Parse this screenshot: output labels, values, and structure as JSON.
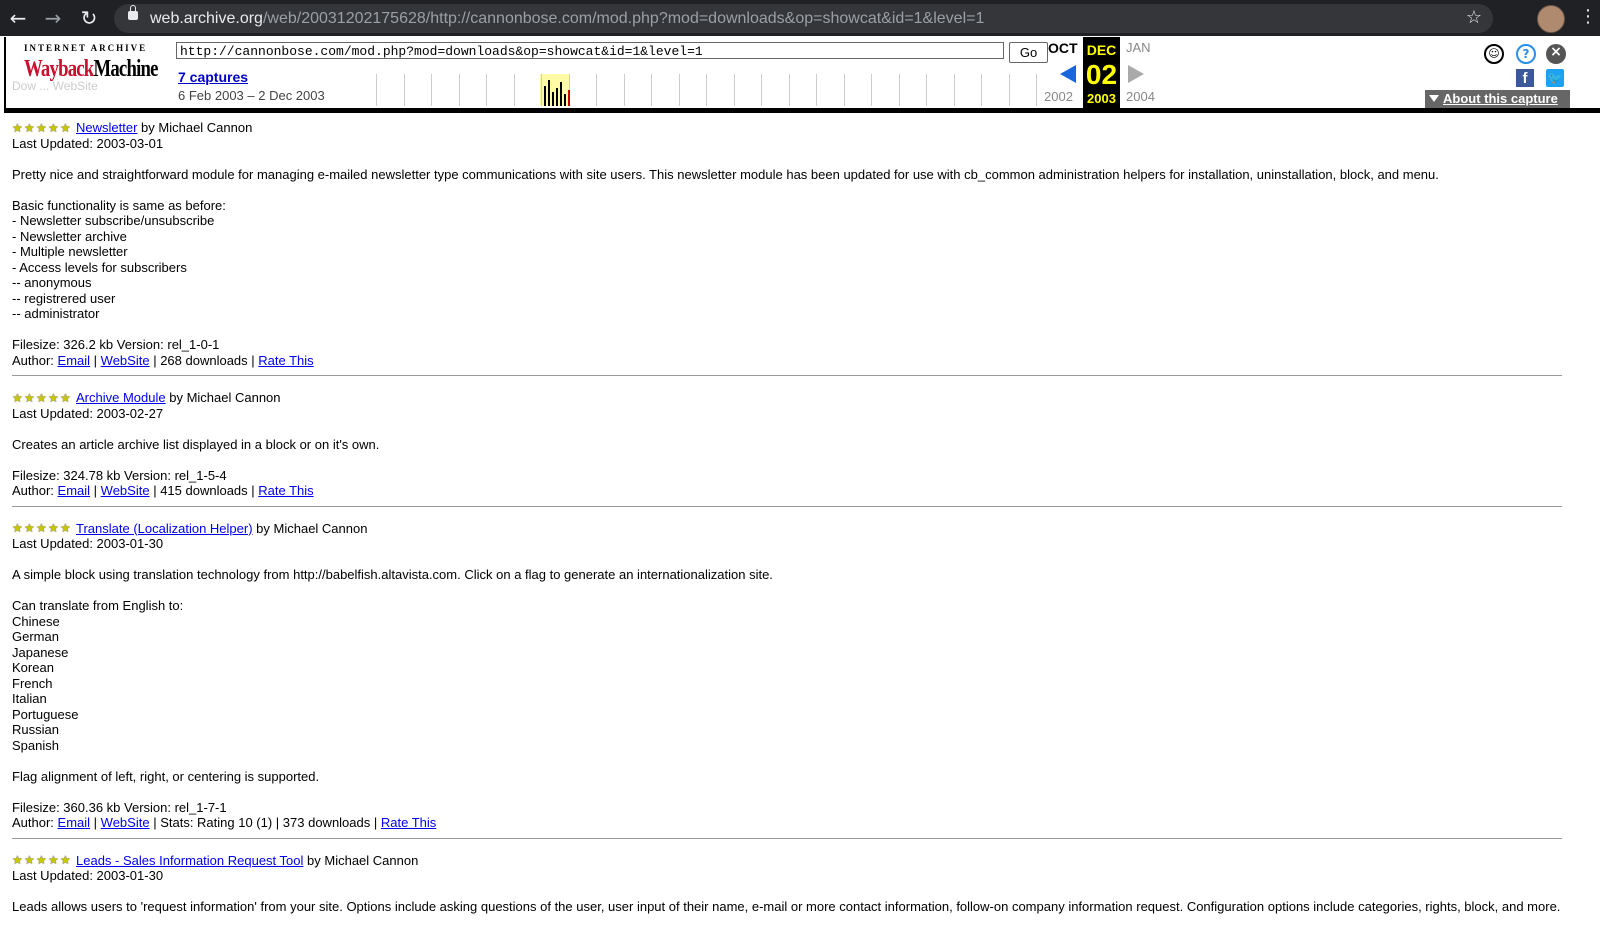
{
  "browser": {
    "url_host": "web.archive.org",
    "url_path": "/web/20031202175628/http://cannonbose.com/mod.php?mod=downloads&op=showcat&id=1&level=1",
    "back_icon": "arrow-left",
    "forward_icon": "arrow-right",
    "reload_icon": "reload",
    "bookmark_icon": "star"
  },
  "wayback": {
    "logo_top": "INTERNET ARCHIVE",
    "logo_main_a": "Wayback",
    "logo_main_b": "Machine",
    "url_value": "http://cannonbose.com/mod.php?mod=downloads&op=showcat&id=1&level=1",
    "go_label": "Go",
    "captures_label": "7 captures",
    "range_label": "6 Feb 2003 – 2 Dec 2003",
    "prev_month": "OCT",
    "cur_month": "DEC",
    "cur_day": "02",
    "next_month": "JAN",
    "prev_year": "2002",
    "cur_year": "2003",
    "next_year": "2004",
    "about_label": "About this capture",
    "ghost_text": "Dow ... WebSite"
  },
  "items": [
    {
      "title": "Newsletter",
      "by": "by Michael Cannon",
      "updated": "Last Updated: 2003-03-01",
      "desc_lines": [
        "Pretty nice and straightforward module for managing e-mailed newsletter type communications with site users. This newsletter module has been updated for use with cb_common administration helpers for installation, uninstallation, block, and menu.",
        "",
        "Basic functionality is same as before:",
        "- Newsletter subscribe/unsubscribe",
        "- Newsletter archive",
        "- Multiple newsletter",
        "- Access levels for subscribers",
        "-- anonymous",
        "-- registrered user",
        "-- administrator"
      ],
      "filesize": "Filesize: 326.2 kb Version: rel_1-0-1",
      "author_prefix": "Author:",
      "email": "Email",
      "website": "WebSite",
      "stats": "| 268 downloads |",
      "rate": "Rate This"
    },
    {
      "title": "Archive Module",
      "by": "by Michael Cannon",
      "updated": "Last Updated: 2003-02-27",
      "desc_lines": [
        "Creates an article archive list displayed in a block or on it's own."
      ],
      "filesize": "Filesize: 324.78 kb Version: rel_1-5-4",
      "author_prefix": "Author:",
      "email": "Email",
      "website": "WebSite",
      "stats": "| 415 downloads |",
      "rate": "Rate This"
    },
    {
      "title": "Translate (Localization Helper)",
      "by": "by Michael Cannon",
      "updated": "Last Updated: 2003-01-30",
      "desc_lines": [
        "A simple block using translation technology from http://babelfish.altavista.com. Click on a flag to generate an internationalization site.",
        "",
        "Can translate from English to:",
        "Chinese",
        "German",
        "Japanese",
        "Korean",
        "French",
        "Italian",
        "Portuguese",
        "Russian",
        "Spanish",
        "",
        "Flag alignment of left, right, or centering is supported."
      ],
      "filesize": "Filesize: 360.36 kb Version: rel_1-7-1",
      "author_prefix": "Author:",
      "email": "Email",
      "website": "WebSite",
      "stats": "| Stats: Rating 10 (1) | 373 downloads |",
      "rate": "Rate This"
    },
    {
      "title": "Leads - Sales Information Request Tool",
      "by": "by Michael Cannon",
      "updated": "Last Updated: 2003-01-30",
      "desc_lines": [
        "Leads allows users to 'request information' from your site. Options include asking questions of the user, user input of their name, e-mail or more contact information, follow-on company information request. Configuration options include categories, rights, block, and more."
      ]
    }
  ]
}
